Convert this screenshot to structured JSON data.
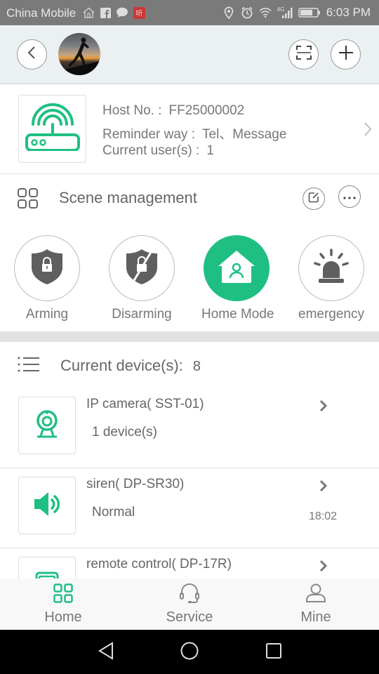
{
  "status_bar": {
    "carrier": "China Mobile",
    "network": "4G",
    "time": "6:03 PM",
    "notification_icons": [
      "home-icon",
      "facebook-icon",
      "chat-bubble-icon",
      "app-badge-icon"
    ],
    "system_icons": [
      "location-icon",
      "alarm-icon",
      "wifi-icon",
      "signal-icon",
      "battery-icon"
    ]
  },
  "top_bar": {
    "back_icon": "chevron-left-icon",
    "avatar": "user-avatar",
    "scan_icon": "scan-icon",
    "add_icon": "plus-icon"
  },
  "host": {
    "host_no_label": "Host No. :",
    "host_no_value": "FF25000002",
    "reminder_label": "Reminder way :",
    "reminder_value": "Tel、Message",
    "users_label": "Current user(s) :",
    "users_value": "1"
  },
  "scene_management": {
    "title": "Scene management",
    "scenes": [
      {
        "label": "Arming",
        "icon": "shield-lock-icon",
        "active": false
      },
      {
        "label": "Disarming",
        "icon": "shield-unlock-icon",
        "active": false
      },
      {
        "label": "Home Mode",
        "icon": "home-person-icon",
        "active": true
      },
      {
        "label": "emergency",
        "icon": "alarm-light-icon",
        "active": false
      }
    ]
  },
  "devices": {
    "title": "Current device(s):",
    "count": "8",
    "items": [
      {
        "name": "IP camera( SST-01)",
        "status": "1 device(s)",
        "time": "",
        "icon": "camera-icon"
      },
      {
        "name": "siren( DP-SR30)",
        "status": "Normal",
        "time": "18:02",
        "icon": "speaker-icon"
      },
      {
        "name": "remote control( DP-17R)",
        "status": "",
        "time": "",
        "icon": "remote-control-icon"
      }
    ]
  },
  "tab_bar": {
    "tabs": [
      {
        "label": "Home",
        "active": true
      },
      {
        "label": "Service",
        "active": false
      },
      {
        "label": "Mine",
        "active": false
      }
    ]
  },
  "colors": {
    "accent": "#1fbf83",
    "status_bar_bg": "#7a7a7a",
    "top_bar_bg": "#ebf1f2",
    "text": "#666666"
  }
}
